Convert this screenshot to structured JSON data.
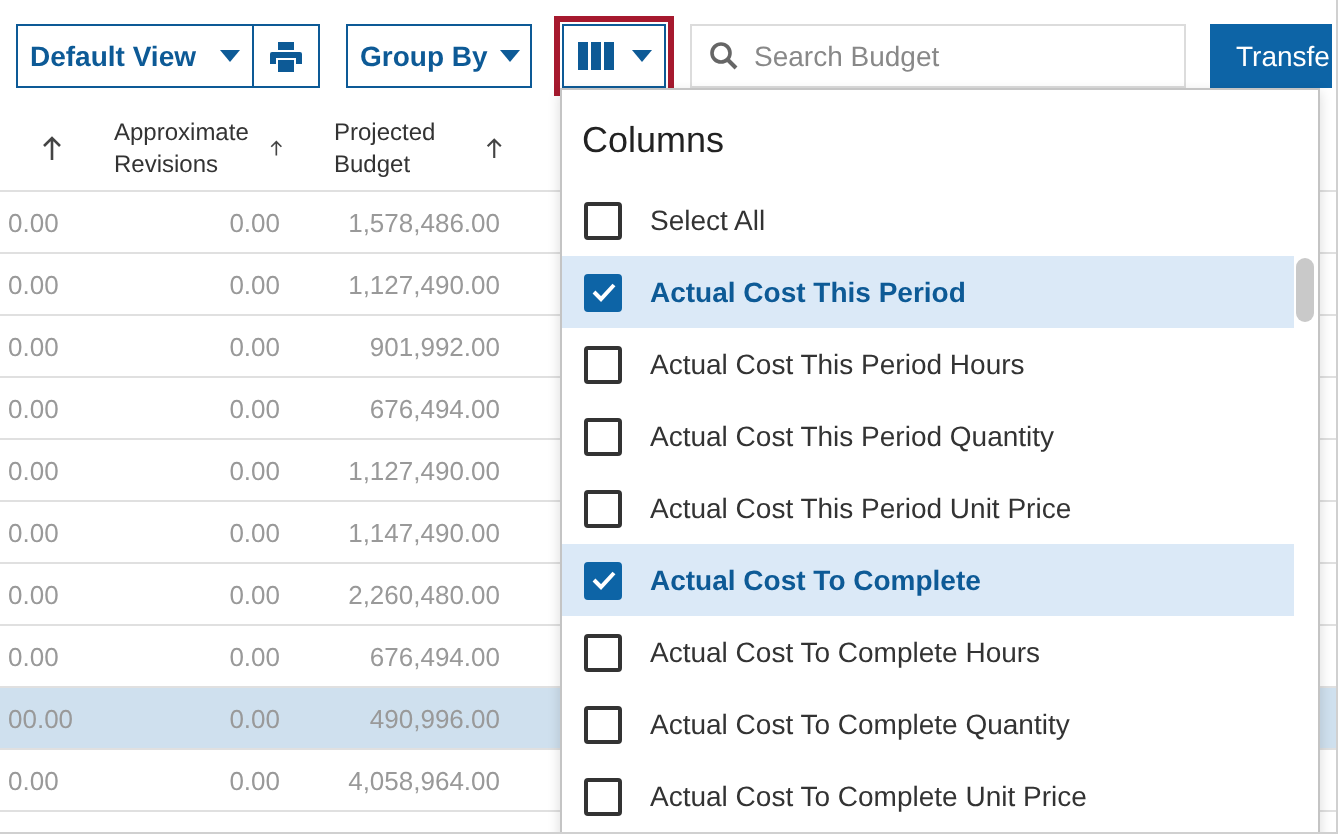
{
  "toolbar": {
    "view_button": "Default View",
    "group_by_button": "Group By",
    "columns_button": {
      "highlighted": true
    },
    "search": {
      "placeholder": "Search Budget"
    },
    "transfer_button": "Transfe"
  },
  "table": {
    "columns": [
      "",
      "Approximate Revisions",
      "Projected Budget"
    ],
    "rows": [
      {
        "cells": [
          "0.00",
          "0.00",
          "1,578,486.00"
        ],
        "selected": false
      },
      {
        "cells": [
          "0.00",
          "0.00",
          "1,127,490.00"
        ],
        "selected": false
      },
      {
        "cells": [
          "0.00",
          "0.00",
          "901,992.00"
        ],
        "selected": false
      },
      {
        "cells": [
          "0.00",
          "0.00",
          "676,494.00"
        ],
        "selected": false
      },
      {
        "cells": [
          "0.00",
          "0.00",
          "1,127,490.00"
        ],
        "selected": false
      },
      {
        "cells": [
          "0.00",
          "0.00",
          "1,147,490.00"
        ],
        "selected": false
      },
      {
        "cells": [
          "0.00",
          "0.00",
          "2,260,480.00"
        ],
        "selected": false
      },
      {
        "cells": [
          "0.00",
          "0.00",
          "676,494.00"
        ],
        "selected": false
      },
      {
        "cells": [
          "00.00",
          "0.00",
          "490,996.00"
        ],
        "selected": true
      },
      {
        "cells": [
          "0.00",
          "0.00",
          "4,058,964.00"
        ],
        "selected": false
      }
    ]
  },
  "column_menu": {
    "title": "Columns",
    "items": [
      {
        "label": "Select All",
        "checked": false
      },
      {
        "label": "Actual Cost This Period",
        "checked": true
      },
      {
        "label": "Actual Cost This Period Hours",
        "checked": false
      },
      {
        "label": "Actual Cost This Period Quantity",
        "checked": false
      },
      {
        "label": "Actual Cost This Period Unit Price",
        "checked": false
      },
      {
        "label": "Actual Cost To Complete",
        "checked": true
      },
      {
        "label": "Actual Cost To Complete Hours",
        "checked": false
      },
      {
        "label": "Actual Cost To Complete Quantity",
        "checked": false
      },
      {
        "label": "Actual Cost To Complete Unit Price",
        "checked": false
      }
    ]
  }
}
